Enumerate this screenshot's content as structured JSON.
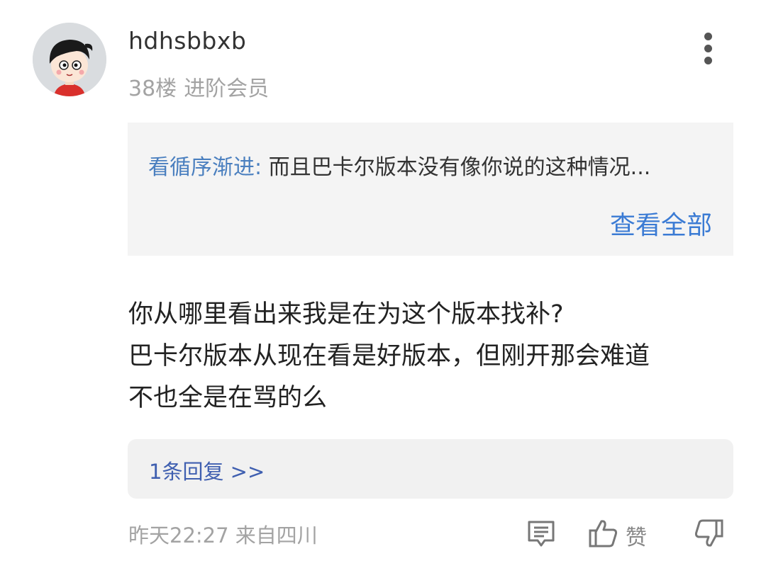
{
  "post": {
    "username": "hdhsbbxb",
    "floor": "38楼",
    "member_level": "进阶会员"
  },
  "quote": {
    "author": "看循序渐进:",
    "excerpt": "而且巴卡尔版本没有像你说的这种情况...",
    "view_all": "查看全部"
  },
  "content": {
    "lines": [
      "你从哪里看出来我是在为这个版本找补?",
      "巴卡尔版本从现在看是好版本，但刚开那会难道",
      "不也全是在骂的么"
    ]
  },
  "replies": {
    "label": "1条回复 >>"
  },
  "footer": {
    "time_location": "昨天22:27 来自四川",
    "like_label": "赞"
  },
  "icons": {
    "avatar": "cartoon-boy-avatar",
    "more": "more-vertical-icon",
    "comment": "comment-icon",
    "like": "thumbs-up-icon",
    "dislike": "thumbs-down-icon"
  },
  "colors": {
    "link_blue": "#3b7bd4",
    "quote_author_blue": "#4a7fbf",
    "reply_blue": "#3f5fb0",
    "meta_gray": "#a3a3a3"
  }
}
